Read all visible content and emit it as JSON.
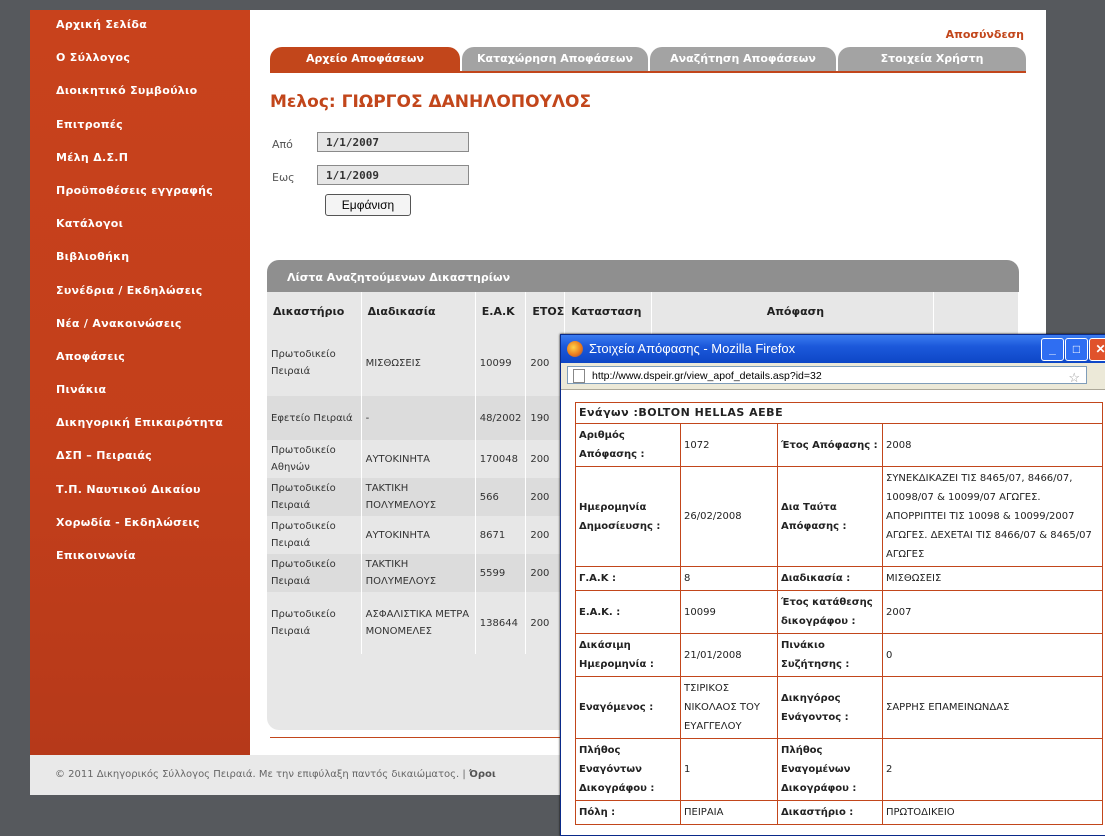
{
  "sidebar": {
    "items": [
      "Αρχική Σελίδα",
      "Ο Σύλλογος",
      "Διοικητικό Συμβούλιο",
      "Επιτροπές",
      "Μέλη Δ.Σ.Π",
      "Προϋποθέσεις εγγραφής",
      "Κατάλογοι",
      "Βιβλιοθήκη",
      "Συνέδρια / Εκδηλώσεις",
      "Νέα / Ανακοινώσεις",
      "Αποφάσεις",
      "Πινάκια",
      "Δικηγορική Επικαιρότητα",
      "ΔΣΠ – Πειραιάς",
      "Τ.Π. Ναυτικού Δικαίου",
      "Χορωδία - Εκδηλώσεις",
      "Επικοινωνία"
    ]
  },
  "header": {
    "logout": "Αποσύνδεση"
  },
  "tabs": [
    "Αρχείο Αποφάσεων",
    "Καταχώρηση Αποφάσεων",
    "Αναζήτηση Αποφάσεων",
    "Στοιχεία Χρήστη"
  ],
  "member_title": "Μελος: ΓΙΩΡΓΟΣ ΔΑΝΗΛΟΠΟΥΛΟΣ",
  "filter": {
    "from_label": "Από",
    "from_value": "1/1/2007",
    "to_label": "Εως",
    "to_value": "1/1/2009",
    "button": "Εμφάνιση"
  },
  "list": {
    "title": "Λίστα Αναζητούμενων Δικαστηρίων",
    "columns": [
      "Δικαστήριο",
      "Διαδικασία",
      "Ε.Α.Κ",
      "ΕΤΟΣ",
      "Κατασταση",
      "Απόφαση"
    ],
    "rows": [
      {
        "court": "Πρωτοδικείο Πειραιά",
        "procedure": "ΜΙΣΘΩΣΕΙΣ",
        "eak": "10099",
        "year": "200"
      },
      {
        "court": "Εφετείο Πειραιά",
        "procedure": "-",
        "eak": "48/2002",
        "year": "190"
      },
      {
        "court": "Πρωτοδικείο Αθηνών",
        "procedure": "ΑΥΤΟΚΙΝΗΤΑ",
        "eak": "170048",
        "year": "200"
      },
      {
        "court": "Πρωτοδικείο Πειραιά",
        "procedure": "ΤΑΚΤΙΚΗ ΠΟΛΥΜΕΛΟΥΣ",
        "eak": "566",
        "year": "200"
      },
      {
        "court": "Πρωτοδικείο Πειραιά",
        "procedure": "ΑΥΤΟΚΙΝΗΤΑ",
        "eak": "8671",
        "year": "200"
      },
      {
        "court": "Πρωτοδικείο Πειραιά",
        "procedure": "ΤΑΚΤΙΚΗ ΠΟΛΥΜΕΛΟΥΣ",
        "eak": "5599",
        "year": "200"
      },
      {
        "court": "Πρωτοδικείο Πειραιά",
        "procedure": "ΑΣΦΑΛΙΣΤΙΚΑ ΜΕΤΡΑ ΜΟΝΟΜΕΛΕΣ",
        "eak": "138644",
        "year": "200"
      }
    ]
  },
  "footer": {
    "text": "© 2011 Δικηγορικός Σύλλογος Πειραιά. Με την επιφύλαξη παντός δικαιώματος. |",
    "link": "Όροι"
  },
  "popup": {
    "title": "Στοιχεία Απόφασης - Mozilla Firefox",
    "url": "http://www.dspeir.gr/view_apof_details.asp?id=32",
    "header": "Ενάγων :BOLTON HELLAS AEBE",
    "fields": {
      "l1": "Αριθμός Απόφασης :",
      "v1": "1072",
      "l2": "Έτος Απόφασης :",
      "v2": "2008",
      "l3": "Ημερομηνία Δημοσίευσης :",
      "v3": "26/02/2008",
      "l4": "Δια Ταύτα Απόφασης :",
      "v4": "ΣΥΝΕΚΔΙΚΑΖΕΙ ΤΙΣ 8465/07, 8466/07, 10098/07 & 10099/07 ΑΓΩΓΕΣ. ΑΠΟΡΡΙΠΤΕΙ ΤΙΣ 10098 & 10099/2007 ΑΓΩΓΕΣ. ΔΕΧΕΤΑΙ ΤΙΣ 8466/07 & 8465/07 ΑΓΩΓΕΣ",
      "l5": "Γ.Α.Κ :",
      "v5": "8",
      "l6": "Διαδικασία :",
      "v6": "ΜΙΣΘΩΣΕΙΣ",
      "l7": "Ε.Α.Κ. :",
      "v7": "10099",
      "l8": "Έτος κατάθεσης δικογράφου :",
      "v8": "2007",
      "l9": "Δικάσιμη Ημερομηνία :",
      "v9": "21/01/2008",
      "l10": "Πινάκιο Συζήτησης :",
      "v10": "0",
      "l11": "Εναγόμενος :",
      "v11": "ΤΣΙΡΙΚΟΣ ΝΙΚΟΛΑΟΣ ΤΟΥ ΕΥΑΓΓΕΛΟΥ",
      "l12": "Δικηγόρος Ενάγοντος :",
      "v12": "ΣΑΡΡΗΣ ΕΠΑΜΕΙΝΩΝΔΑΣ",
      "l13": "Πλήθος Εναγόντων Δικογράφου :",
      "v13": "1",
      "l14": "Πλήθος Εναγομένων Δικογράφου :",
      "v14": "2",
      "l15": "Πόλη :",
      "v15": "ΠΕΙΡΑΙΑ",
      "l16": "Δικαστήριο :",
      "v16": "ΠΡΩΤΟΔΙΚΕΙΟ"
    }
  },
  "colors": {
    "accent": "#c2461b",
    "sidebar": "#c3401b",
    "backdrop": "#56595d"
  }
}
